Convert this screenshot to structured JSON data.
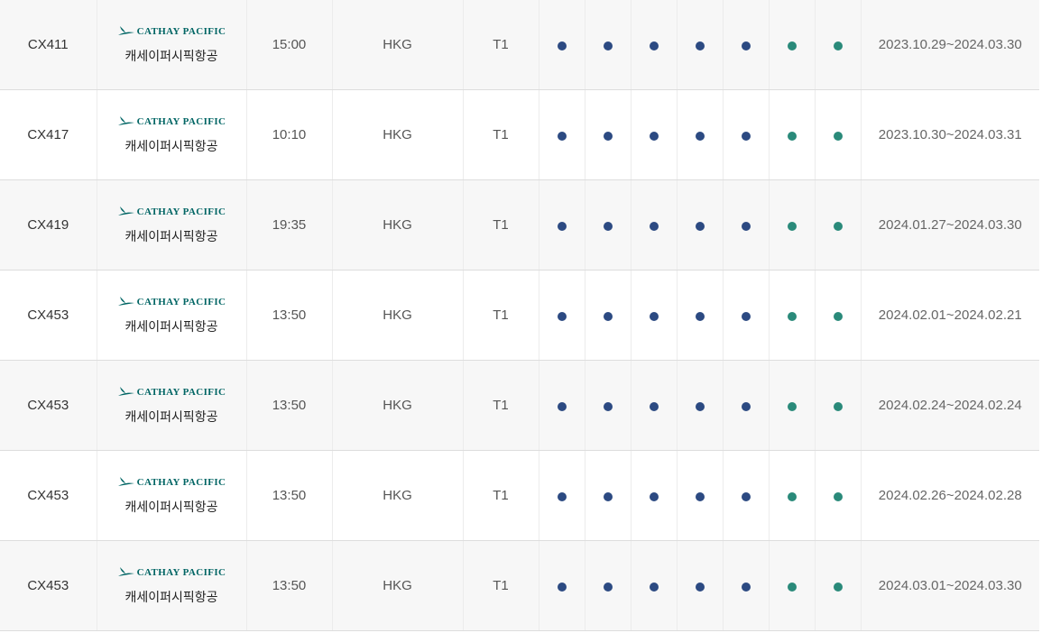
{
  "colors": {
    "weekday_dot": "#2c4a82",
    "weekend_dot": "#2a8a7a",
    "logo_teal": "#006564"
  },
  "airline": {
    "logo_text": "CATHAY PACIFIC",
    "logo_icon": "cathay-brushwing-icon",
    "name_kr": "캐세이퍼시픽항공"
  },
  "rows": [
    {
      "flight": "CX411",
      "time": "15:00",
      "airport": "HKG",
      "terminal": "T1",
      "period": "2023.10.29~2024.03.30"
    },
    {
      "flight": "CX417",
      "time": "10:10",
      "airport": "HKG",
      "terminal": "T1",
      "period": "2023.10.30~2024.03.31"
    },
    {
      "flight": "CX419",
      "time": "19:35",
      "airport": "HKG",
      "terminal": "T1",
      "period": "2024.01.27~2024.03.30"
    },
    {
      "flight": "CX453",
      "time": "13:50",
      "airport": "HKG",
      "terminal": "T1",
      "period": "2024.02.01~2024.02.21"
    },
    {
      "flight": "CX453",
      "time": "13:50",
      "airport": "HKG",
      "terminal": "T1",
      "period": "2024.02.24~2024.02.24"
    },
    {
      "flight": "CX453",
      "time": "13:50",
      "airport": "HKG",
      "terminal": "T1",
      "period": "2024.02.26~2024.02.28"
    },
    {
      "flight": "CX453",
      "time": "13:50",
      "airport": "HKG",
      "terminal": "T1",
      "period": "2024.03.01~2024.03.30"
    }
  ]
}
